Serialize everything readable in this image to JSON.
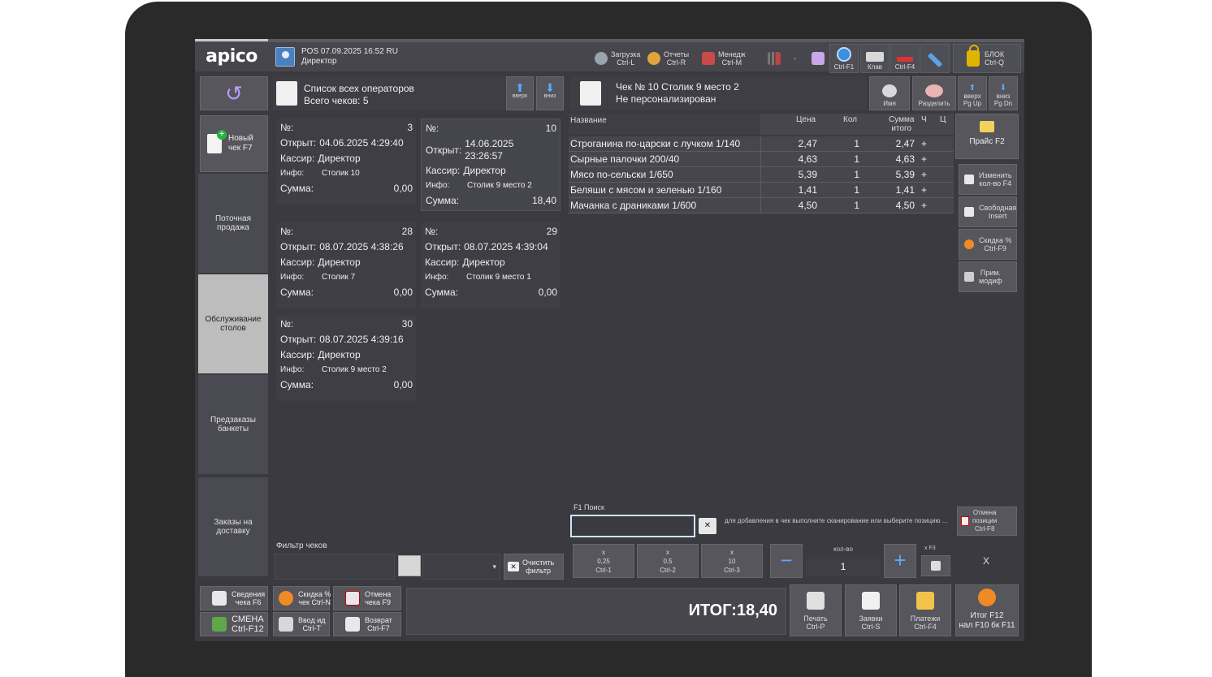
{
  "topbar": {
    "logo": "apico",
    "pos_line1": "POS 07.09.2025 16:52  RU",
    "pos_line2": "Директор",
    "zagruzka": "Загрузка\nCtrl-L",
    "otchety": "Отчеты\nCtrl-R",
    "menedzh": "Менедж\nCtrl-M",
    "dash": "-",
    "help": "Ctrl-F1",
    "klav": "Клав",
    "ctrlf4": "Ctrl-F4",
    "lock": "БЛОК\nCtrl-Q"
  },
  "nav": {
    "new_check": "Новый\nчек F7",
    "items": [
      "Поточная\nпродажа",
      "Обслуживание\nстолов",
      "Предзаказы\nбанкеты",
      "Заказы на\nдоставку"
    ]
  },
  "checks_panel": {
    "title": "Список всех операторов",
    "total": "Всего чеков: 5",
    "up": "вверх",
    "down": "вниз",
    "labels": {
      "no": "№:",
      "opened": "Открыт:",
      "cashier": "Кассир:",
      "info": "Инфо:",
      "sum": "Сумма:"
    },
    "cards": [
      {
        "no": "3",
        "opened": "04.06.2025 4:29:40",
        "cashier": "Директор",
        "info": "Столик 10",
        "sum": "0,00"
      },
      {
        "no": "10",
        "opened": "14.06.2025",
        "opened2": "23:26:57",
        "cashier": "Директор",
        "info": "Столик 9 место 2",
        "sum": "18,40"
      },
      {
        "no": "28",
        "opened": "08.07.2025 4:38:26",
        "cashier": "Директор",
        "info": "Столик 7",
        "sum": "0,00"
      },
      {
        "no": "29",
        "opened": "08.07.2025 4:39:04",
        "cashier": "Директор",
        "info": "Столик 9 место 1",
        "sum": "0,00"
      },
      {
        "no": "30",
        "opened": "08.07.2025 4:39:16",
        "cashier": "Директор",
        "info": "Столик 9 место 2",
        "sum": "0,00"
      }
    ],
    "filter_label": "Фильтр чеков",
    "filter_select": "▾",
    "clear_filter": "Очистить\nфильтр"
  },
  "check": {
    "title": "Чек № 10 Столик 9 место 2",
    "subtitle": "Не персонализирован",
    "btn_name": "Имя",
    "btn_split": "Разделить",
    "btn_up": "вверх\nPg Up",
    "btn_down": "вниз\nPg Dn",
    "columns": {
      "name": "Название",
      "price": "Цена",
      "qty": "Кол",
      "sum": "Сумма\nитого",
      "ch": "Ч",
      "ts": "Ц"
    },
    "rows": [
      {
        "name": "Строганина по-царски с лучком 1/140",
        "price": "2,47",
        "qty": "1",
        "sum": "2,47",
        "mark": "+"
      },
      {
        "name": "Сырные палочки 200/40",
        "price": "4,63",
        "qty": "1",
        "sum": "4,63",
        "mark": "+"
      },
      {
        "name": "Мясо по-сельски 1/650",
        "price": "5,39",
        "qty": "1",
        "sum": "5,39",
        "mark": "+"
      },
      {
        "name": "Беляши с мясом и зеленью 1/160",
        "price": "1,41",
        "qty": "1",
        "sum": "1,41",
        "mark": "+"
      },
      {
        "name": "Мачанка с драниками 1/600",
        "price": "4,50",
        "qty": "1",
        "sum": "4,50",
        "mark": "+"
      }
    ]
  },
  "right_panel": {
    "price": "Прайс F2",
    "change_qty": "Изменить\nкол-во F4",
    "free": "Свободная\nInsert",
    "discount": "Скидка %\nCtrl-F9",
    "modif": "Прим.\nмодиф",
    "cancel_pos": "Отмена\nпозиции\nCtrl-F8"
  },
  "search": {
    "label": "F1 Поиск",
    "value": "",
    "hint": "для добавления в чек выполните сканирование или выберите позицию ..."
  },
  "qty": {
    "btn1": "x\n0,25\nCtrl-1",
    "btn2": "x\n0,5\nCtrl-2",
    "btn3": "x\n10\nCtrl-3",
    "minus": "−",
    "plus": "+",
    "label": "кол-во",
    "value": "1",
    "f3": "x F3",
    "x": "X"
  },
  "bottom": {
    "info": "Сведения\nчека F6",
    "discount": "Скидка %\nчек Ctrl-N",
    "cancel": "Отмена\nчека F9",
    "shift": "СМЕНА\nCtrl-F12",
    "input_id": "Ввод ид\nCtrl-T",
    "return": "Возврат\nCtrl-F7",
    "total": "ИТОГ:18,40",
    "print": "Печать\nCtrl-P",
    "orders": "Заявки\nCtrl-S",
    "payments": "Платежи\nCtrl-F4",
    "itog": "Итог F12\nнал F10 бк F11"
  }
}
